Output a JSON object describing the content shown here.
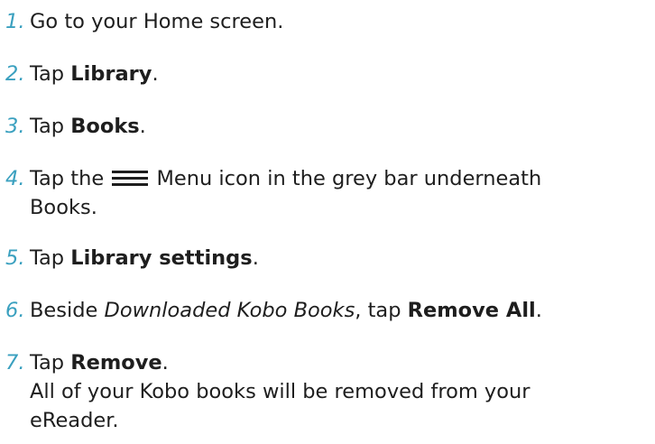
{
  "steps": [
    {
      "number": "1.",
      "line1": "Go to your Home screen."
    },
    {
      "number": "2.",
      "prefix": "Tap ",
      "bold": "Library",
      "suffix": "."
    },
    {
      "number": "3.",
      "prefix": "Tap ",
      "bold": "Books",
      "suffix": "."
    },
    {
      "number": "4.",
      "prefix": "Tap the",
      "suffix": " Menu icon in the grey bar underneath",
      "line2": "Books.",
      "icon": "menu-icon"
    },
    {
      "number": "5.",
      "prefix": "Tap ",
      "bold": "Library settings",
      "suffix": "."
    },
    {
      "number": "6.",
      "prefix": "Beside ",
      "italic": "Downloaded Kobo Books",
      "middle": ", tap ",
      "bold": "Remove All",
      "suffix": "."
    },
    {
      "number": "7.",
      "prefix": "Tap ",
      "bold": "Remove",
      "suffix": ".",
      "line2": "All of your Kobo books will be removed from your",
      "line3": "eReader."
    }
  ],
  "colors": {
    "number": "#3aa0bf",
    "text": "#1e1e1e"
  }
}
